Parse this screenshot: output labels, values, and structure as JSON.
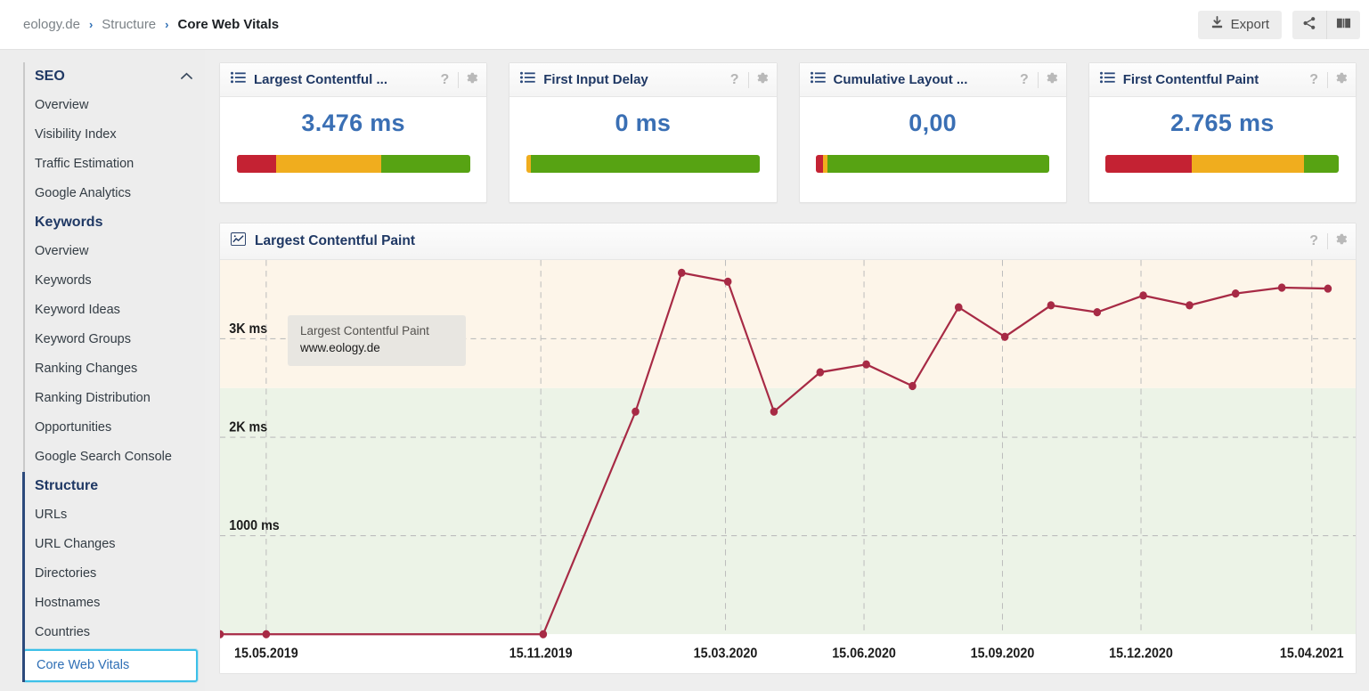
{
  "breadcrumb": {
    "items": [
      "eology.de",
      "Structure",
      "Core Web Vitals"
    ],
    "separator": "›"
  },
  "toolbar": {
    "export_label": "Export",
    "export_icon": "download-icon",
    "share_icon": "share-icon",
    "manual_icon": "book-icon"
  },
  "sidebar": {
    "groups": [
      {
        "title": "SEO",
        "collapse_icon": "chevron-up-icon",
        "active": false,
        "items": [
          "Overview",
          "Visibility Index",
          "Traffic Estimation",
          "Google Analytics"
        ]
      },
      {
        "title": "Keywords",
        "active": false,
        "items": [
          "Overview",
          "Keywords",
          "Keyword Ideas",
          "Keyword Groups",
          "Ranking Changes",
          "Ranking Distribution",
          "Opportunities",
          "Google Search Console"
        ]
      },
      {
        "title": "Structure",
        "active": true,
        "items": [
          "URLs",
          "URL Changes",
          "Directories",
          "Hostnames",
          "Countries",
          "Core Web Vitals"
        ]
      }
    ],
    "selected_item": "Core Web Vitals",
    "selected_border_color": "#3cc0e8",
    "active_group_color": "#2c4a7c"
  },
  "cards": [
    {
      "title": "Largest Contentful ...",
      "value": "3.476 ms",
      "icon": "list-icon",
      "help_icon": "question-icon",
      "settings_icon": "gear-icon",
      "bar": [
        {
          "color": "#c42233",
          "pct": 17
        },
        {
          "color": "#f0ad1e",
          "pct": 45
        },
        {
          "color": "#57a313",
          "pct": 38
        }
      ]
    },
    {
      "title": "First Input Delay",
      "value": "0 ms",
      "icon": "list-icon",
      "help_icon": "question-icon",
      "settings_icon": "gear-icon",
      "bar": [
        {
          "color": "#f0ad1e",
          "pct": 2
        },
        {
          "color": "#57a313",
          "pct": 98
        }
      ]
    },
    {
      "title": "Cumulative Layout ...",
      "value": "0,00",
      "icon": "list-icon",
      "help_icon": "question-icon",
      "settings_icon": "gear-icon",
      "bar": [
        {
          "color": "#c42233",
          "pct": 3
        },
        {
          "color": "#f0ad1e",
          "pct": 2
        },
        {
          "color": "#57a313",
          "pct": 95
        }
      ]
    },
    {
      "title": "First Contentful Paint",
      "value": "2.765 ms",
      "icon": "list-icon",
      "help_icon": "question-icon",
      "settings_icon": "gear-icon",
      "bar": [
        {
          "color": "#c42233",
          "pct": 37
        },
        {
          "color": "#f0ad1e",
          "pct": 48
        },
        {
          "color": "#57a313",
          "pct": 15
        }
      ]
    }
  ],
  "chart_panel": {
    "title": "Largest Contentful Paint",
    "icon": "chart-icon",
    "help_icon": "question-icon",
    "settings_icon": "gear-icon",
    "legend": {
      "metric": "Largest Contentful Paint",
      "domain": "www.eology.de"
    }
  },
  "chart_data": {
    "type": "line",
    "title": "Largest Contentful Paint",
    "xlabel": "",
    "ylabel": "ms",
    "ytick_labels": [
      "1000 ms",
      "2K ms",
      "3K ms"
    ],
    "ytick_values": [
      1000,
      2000,
      3000
    ],
    "ylim": [
      0,
      3800
    ],
    "xtick_labels": [
      "15.05.2019",
      "15.11.2019",
      "15.03.2020",
      "15.06.2020",
      "15.09.2020",
      "15.12.2020",
      "15.04.2021"
    ],
    "grid": true,
    "legend_position": "inside-top-left",
    "line_color": "#a72a45",
    "bands": [
      {
        "from": 0,
        "to": 2500,
        "color": "#ecf3e7",
        "label": "good"
      },
      {
        "from": 2500,
        "to": 3800,
        "color": "#fdf5e9",
        "label": "needs-improvement"
      }
    ],
    "series": [
      {
        "name": "Largest Contentful Paint - www.eology.de",
        "points": [
          {
            "x": 0,
            "y": 0
          },
          {
            "x": 1,
            "y": 0
          },
          {
            "x": 7,
            "y": 0
          },
          {
            "x": 9,
            "y": 2260
          },
          {
            "x": 10,
            "y": 3670
          },
          {
            "x": 11,
            "y": 3580
          },
          {
            "x": 12,
            "y": 2260
          },
          {
            "x": 13,
            "y": 2660
          },
          {
            "x": 14,
            "y": 2740
          },
          {
            "x": 15,
            "y": 2520
          },
          {
            "x": 16,
            "y": 3320
          },
          {
            "x": 17,
            "y": 3020
          },
          {
            "x": 18,
            "y": 3340
          },
          {
            "x": 19,
            "y": 3270
          },
          {
            "x": 20,
            "y": 3440
          },
          {
            "x": 21,
            "y": 3340
          },
          {
            "x": 22,
            "y": 3460
          },
          {
            "x": 23,
            "y": 3520
          },
          {
            "x": 24,
            "y": 3510
          }
        ]
      }
    ]
  }
}
